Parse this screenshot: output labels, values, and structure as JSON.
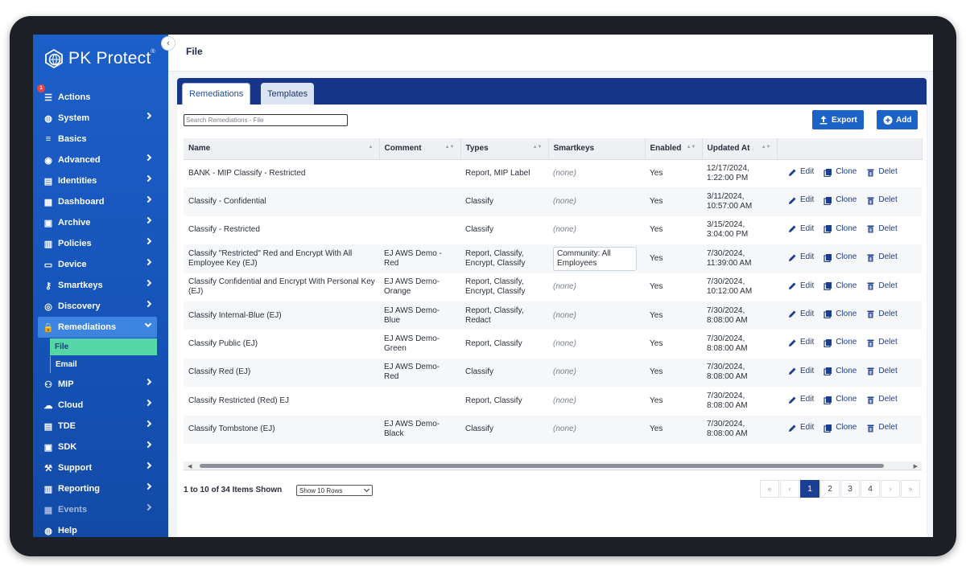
{
  "app": {
    "brand": "PK Protect",
    "brand_mark": "®"
  },
  "sidebar": {
    "items": [
      {
        "label": "Actions",
        "icon": "actions-icon",
        "badge": "1",
        "chevron": false
      },
      {
        "label": "System",
        "icon": "globe-icon",
        "chevron": true
      },
      {
        "label": "Basics",
        "icon": "sliders-icon",
        "chevron": false
      },
      {
        "label": "Advanced",
        "icon": "location-icon",
        "chevron": true
      },
      {
        "label": "Identities",
        "icon": "id-card-icon",
        "chevron": true
      },
      {
        "label": "Dashboard",
        "icon": "dashboard-icon",
        "chevron": true
      },
      {
        "label": "Archive",
        "icon": "archive-icon",
        "chevron": true
      },
      {
        "label": "Policies",
        "icon": "policy-icon",
        "chevron": true
      },
      {
        "label": "Device",
        "icon": "device-icon",
        "chevron": true
      },
      {
        "label": "Smartkeys",
        "icon": "key-icon",
        "chevron": true
      },
      {
        "label": "Discovery",
        "icon": "discovery-icon",
        "chevron": true
      },
      {
        "label": "Remediations",
        "icon": "lock-icon",
        "chevron": true,
        "open": true
      }
    ],
    "sub_items": [
      {
        "label": "File",
        "active": true
      },
      {
        "label": "Email",
        "active": false
      }
    ],
    "items_after": [
      {
        "label": "MIP",
        "icon": "users-icon",
        "chevron": true
      },
      {
        "label": "Cloud",
        "icon": "cloud-icon",
        "chevron": true
      },
      {
        "label": "TDE",
        "icon": "tde-icon",
        "chevron": true
      },
      {
        "label": "SDK",
        "icon": "sdk-icon",
        "chevron": true
      },
      {
        "label": "Support",
        "icon": "wrench-icon",
        "chevron": true
      },
      {
        "label": "Reporting",
        "icon": "report-icon",
        "chevron": true
      },
      {
        "label": "Events",
        "icon": "calendar-icon",
        "chevron": true,
        "dim": true
      },
      {
        "label": "Help",
        "icon": "help-icon",
        "chevron": false
      }
    ]
  },
  "page": {
    "title": "File"
  },
  "tabs": [
    {
      "label": "Remediations"
    },
    {
      "label": "Templates"
    }
  ],
  "toolbar": {
    "search_placeholder": "Search Remediations - File",
    "export_label": "Export",
    "add_label": "Add"
  },
  "table": {
    "columns": [
      "Name",
      "Comment",
      "Types",
      "Smartkeys",
      "Enabled",
      "Updated At",
      ""
    ],
    "actions": {
      "edit": "Edit",
      "clone": "Clone",
      "delete": "Delet"
    },
    "rows": [
      {
        "name": "BANK - MIP Classify - Restricted",
        "comment": "",
        "types": "Report, MIP Label",
        "smartkeys": "(none)",
        "enabled": "Yes",
        "updated": "12/17/2024,\n1:22:00 PM"
      },
      {
        "name": "Classify - Confidential",
        "comment": "",
        "types": "Classify",
        "smartkeys": "(none)",
        "enabled": "Yes",
        "updated": "3/11/2024,\n10:57:00 AM"
      },
      {
        "name": "Classify - Restricted",
        "comment": "",
        "types": "Classify",
        "smartkeys": "(none)",
        "enabled": "Yes",
        "updated": "3/15/2024,\n3:04:00 PM"
      },
      {
        "name": "Classify \"Restricted\" Red and Encrypt With All Employee Key (EJ)",
        "comment": "EJ AWS Demo -\nRed",
        "types": "Report, Classify,\nEncrypt, Classify",
        "smartkeys": "Community: All Employees",
        "smart_box": true,
        "enabled": "Yes",
        "updated": "7/30/2024,\n11:39:00 AM"
      },
      {
        "name": "Classify Confidential and Encrypt With Personal Key (EJ)",
        "comment": "EJ AWS Demo-\nOrange",
        "types": "Report, Classify,\nEncrypt, Classify",
        "smartkeys": "(none)",
        "enabled": "Yes",
        "updated": "7/30/2024,\n10:12:00 AM"
      },
      {
        "name": "Classify Internal-Blue (EJ)",
        "comment": "EJ AWS Demo-\nBlue",
        "types": "Report, Classify,\nRedact",
        "smartkeys": "(none)",
        "enabled": "Yes",
        "updated": "7/30/2024,\n8:08:00 AM"
      },
      {
        "name": "Classify Public (EJ)",
        "comment": "EJ AWS Demo-\nGreen",
        "types": "Report, Classify",
        "smartkeys": "(none)",
        "enabled": "Yes",
        "updated": "7/30/2024,\n8:08:00 AM"
      },
      {
        "name": "Classify Red (EJ)",
        "comment": "EJ AWS Demo-\nRed",
        "types": "Classify",
        "smartkeys": "(none)",
        "enabled": "Yes",
        "updated": "7/30/2024,\n8:08:00 AM"
      },
      {
        "name": "Classify Restricted (Red) EJ",
        "comment": "",
        "types": "Report, Classify",
        "smartkeys": "(none)",
        "enabled": "Yes",
        "updated": "7/30/2024,\n8:08:00 AM"
      },
      {
        "name": "Classify Tombstone (EJ)",
        "comment": "EJ AWS Demo-\nBlack",
        "types": "Classify",
        "smartkeys": "(none)",
        "enabled": "Yes",
        "updated": "7/30/2024,\n8:08:00 AM"
      }
    ]
  },
  "footer": {
    "count_text": "1 to 10 of 34 Items Shown",
    "rows_select": "Show 10 Rows",
    "pages": [
      "«",
      "‹",
      "1",
      "2",
      "3",
      "4",
      "›",
      "»"
    ],
    "current_page": "1"
  },
  "colors": {
    "sidebar": "#1d5fc9",
    "accent": "#1b63c7",
    "tabbar": "#17368a",
    "active_sub": "#56d7a8"
  }
}
